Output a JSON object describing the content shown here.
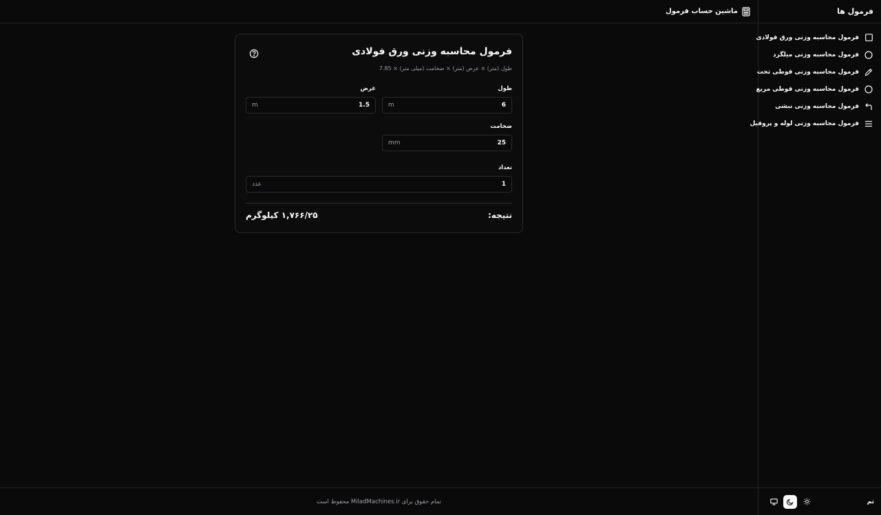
{
  "sidebar": {
    "title": "فرمول ها",
    "items": [
      {
        "label": "فرمول محاسبه وزنی ورق فولادی",
        "icon": "square-icon"
      },
      {
        "label": "فرمول محاسبه وزنی میلگرد",
        "icon": "circle-icon"
      },
      {
        "label": "فرمول محاسبه وزنی قوطی تخت",
        "icon": "pen-icon"
      },
      {
        "label": "فرمول محاسبه وزنی قوطی مربع",
        "icon": "circle-icon"
      },
      {
        "label": "فرمول محاسبه وزنی نبشی",
        "icon": "corner-arrow-icon"
      },
      {
        "label": "فرمول محاسبه وزنی لوله و پروفیل",
        "icon": "menu-lines-icon"
      }
    ],
    "theme_label": "تم",
    "theme_options": [
      "sun-icon",
      "moon-icon",
      "monitor-icon"
    ],
    "theme_selected": "moon-icon"
  },
  "header": {
    "title": "ماشین حساب فرمول",
    "icon": "calculator-icon"
  },
  "card": {
    "title": "فرمول محاسبه وزنی ورق فولادی",
    "subtitle": "طول (متر) × عرض (متر) × ضخامت (میلی متر) × 7.85",
    "fields": {
      "length": {
        "label": "طول",
        "value": "6",
        "unit": "m"
      },
      "width": {
        "label": "عرض",
        "value": "1.5",
        "unit": "m"
      },
      "thickness": {
        "label": "ضخامت",
        "value": "25",
        "unit": "mm"
      },
      "count": {
        "label": "تعداد",
        "value": "1",
        "unit": "عدد"
      }
    },
    "result_label": "نتیجه:",
    "result_value": "۱,۷۶۶/۲۵ کیلوگرم"
  },
  "footer": {
    "text": "تمام حقوق برای MiladMachines.ir محفوظ است"
  },
  "colors": {
    "background": "#0a0a0b",
    "border": "#232327",
    "text": "#fafafa",
    "muted": "#a1a1aa"
  }
}
